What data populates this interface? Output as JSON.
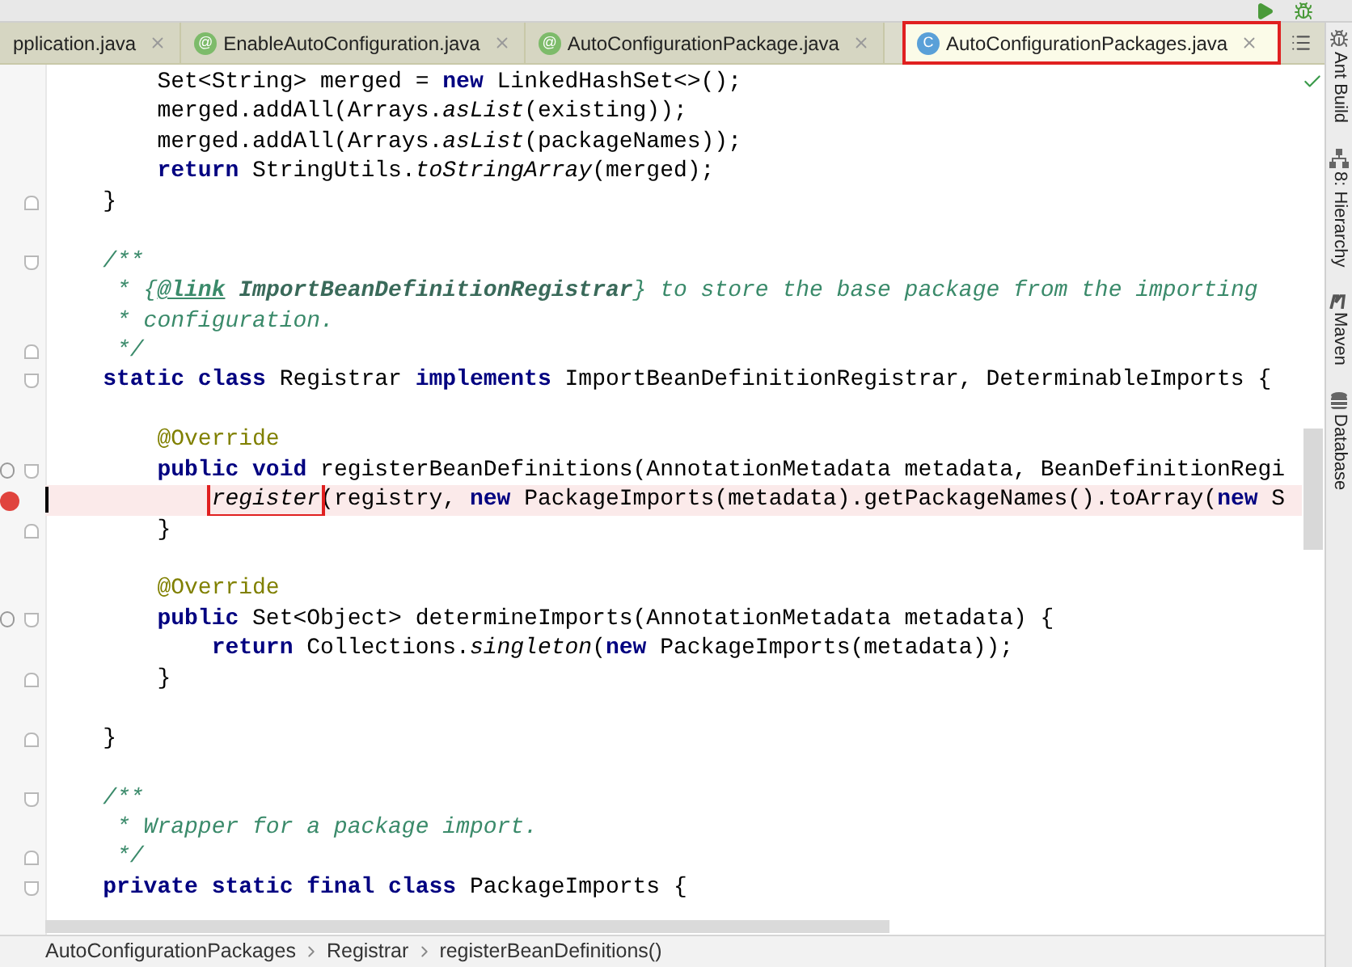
{
  "tabs": [
    {
      "label": "pplication.java",
      "selected": false,
      "highlighted": false
    },
    {
      "label": "EnableAutoConfiguration.java",
      "icon": "@",
      "kind": "annotation",
      "selected": false,
      "highlighted": false
    },
    {
      "label": "AutoConfigurationPackage.java",
      "icon": "@",
      "kind": "annotation",
      "selected": false,
      "highlighted": false
    },
    {
      "label": "AutoConfigurationPackages.java",
      "icon": "C",
      "kind": "class",
      "selected": true,
      "highlighted": true
    }
  ],
  "code_lines": [
    {
      "current": false,
      "tokens": [
        {
          "t": "        Set<String> merged = ",
          "kind": "plain"
        },
        {
          "t": "new",
          "kind": "kw"
        },
        {
          "t": " LinkedHashSet<>();",
          "kind": "plain"
        }
      ]
    },
    {
      "current": false,
      "tokens": [
        {
          "t": "        merged.addAll(Arrays.",
          "kind": "plain"
        },
        {
          "t": "asList",
          "kind": "italic"
        },
        {
          "t": "(existing));",
          "kind": "plain"
        }
      ]
    },
    {
      "current": false,
      "tokens": [
        {
          "t": "        merged.addAll(Arrays.",
          "kind": "plain"
        },
        {
          "t": "asList",
          "kind": "italic"
        },
        {
          "t": "(packageNames));",
          "kind": "plain"
        }
      ]
    },
    {
      "current": false,
      "tokens": [
        {
          "t": "        return",
          "kind": "kw"
        },
        {
          "t": " StringUtils.",
          "kind": "plain"
        },
        {
          "t": "toStringArray",
          "kind": "italic"
        },
        {
          "t": "(merged);",
          "kind": "plain"
        }
      ]
    },
    {
      "kind": "fold_end",
      "current": false,
      "tokens": [
        {
          "t": "    }",
          "kind": "plain"
        }
      ]
    },
    {
      "current": false
    },
    {
      "kind": "fold_start",
      "current": false,
      "tokens": [
        {
          "t": "    /**",
          "kind": "comment"
        }
      ]
    },
    {
      "current": false,
      "tokens": [
        {
          "t": "     * {",
          "kind": "comment"
        },
        {
          "t": "@link",
          "kind": "doctag"
        },
        {
          "t": " ImportBeanDefinitionRegistrar",
          "kind": "doclink"
        },
        {
          "t": "} to store the base package from the importing",
          "kind": "comment"
        }
      ]
    },
    {
      "current": false,
      "tokens": [
        {
          "t": "     * configuration.",
          "kind": "comment"
        }
      ]
    },
    {
      "kind": "fold_end",
      "current": false,
      "tokens": [
        {
          "t": "     */",
          "kind": "comment"
        }
      ]
    },
    {
      "kind": "fold_start",
      "current": false,
      "tokens": [
        {
          "t": "    static class",
          "kind": "kw"
        },
        {
          "t": " Registrar ",
          "kind": "plain"
        },
        {
          "t": "implements",
          "kind": "kw"
        },
        {
          "t": " ImportBeanDefinitionRegistrar, DeterminableImports {",
          "kind": "plain"
        }
      ]
    },
    {
      "current": false
    },
    {
      "current": false,
      "tokens": [
        {
          "t": "        @Override",
          "kind": "annotation"
        }
      ]
    },
    {
      "kind": "override",
      "current": false,
      "tokens": [
        {
          "t": "        public void",
          "kind": "kw"
        },
        {
          "t": " registerBeanDefinitions(AnnotationMetadata metadata, BeanDefinitionRegi",
          "kind": "plain"
        }
      ]
    },
    {
      "kind": "breakpoint",
      "current": true,
      "tokens": [
        {
          "t": "            register",
          "kind": "italic",
          "boxed": true
        },
        {
          "t": "(registry, ",
          "kind": "plain"
        },
        {
          "t": "new",
          "kind": "kw"
        },
        {
          "t": " PackageImports(metadata).getPackageNames().toArray(",
          "kind": "plain"
        },
        {
          "t": "new",
          "kind": "kw"
        },
        {
          "t": " S",
          "kind": "plain"
        }
      ]
    },
    {
      "kind": "fold_end",
      "current": false,
      "tokens": [
        {
          "t": "        }",
          "kind": "plain"
        }
      ]
    },
    {
      "current": false
    },
    {
      "current": false,
      "tokens": [
        {
          "t": "        @Override",
          "kind": "annotation"
        }
      ]
    },
    {
      "kind": "override",
      "current": false,
      "tokens": [
        {
          "t": "        public",
          "kind": "kw"
        },
        {
          "t": " Set<Object> determineImports(AnnotationMetadata metadata) {",
          "kind": "plain"
        }
      ]
    },
    {
      "current": false,
      "tokens": [
        {
          "t": "            return",
          "kind": "kw"
        },
        {
          "t": " Collections.",
          "kind": "plain"
        },
        {
          "t": "singleton",
          "kind": "italic"
        },
        {
          "t": "(",
          "kind": "plain"
        },
        {
          "t": "new",
          "kind": "kw"
        },
        {
          "t": " PackageImports(metadata));",
          "kind": "plain"
        }
      ]
    },
    {
      "kind": "fold_end",
      "current": false,
      "tokens": [
        {
          "t": "        }",
          "kind": "plain"
        }
      ]
    },
    {
      "current": false
    },
    {
      "kind": "fold_end",
      "current": false,
      "tokens": [
        {
          "t": "    }",
          "kind": "plain"
        }
      ]
    },
    {
      "current": false
    },
    {
      "kind": "fold_start",
      "current": false,
      "tokens": [
        {
          "t": "    /**",
          "kind": "comment"
        }
      ]
    },
    {
      "current": false,
      "tokens": [
        {
          "t": "     * Wrapper for a package import.",
          "kind": "comment"
        }
      ]
    },
    {
      "kind": "fold_end",
      "current": false,
      "tokens": [
        {
          "t": "     */",
          "kind": "comment"
        }
      ]
    },
    {
      "kind": "fold_start",
      "current": false,
      "tokens": [
        {
          "t": "    private static final class",
          "kind": "kw"
        },
        {
          "t": " PackageImports {",
          "kind": "plain"
        }
      ]
    }
  ],
  "tool_windows": [
    {
      "label": "Ant Build",
      "kind": "ant"
    },
    {
      "label": "8: Hierarchy",
      "kind": "hierarchy"
    },
    {
      "label": "Maven",
      "kind": "maven"
    },
    {
      "label": "Database",
      "kind": "database"
    }
  ],
  "breadcrumbs": [
    "AutoConfigurationPackages",
    "Registrar",
    "registerBeanDefinitions()"
  ]
}
